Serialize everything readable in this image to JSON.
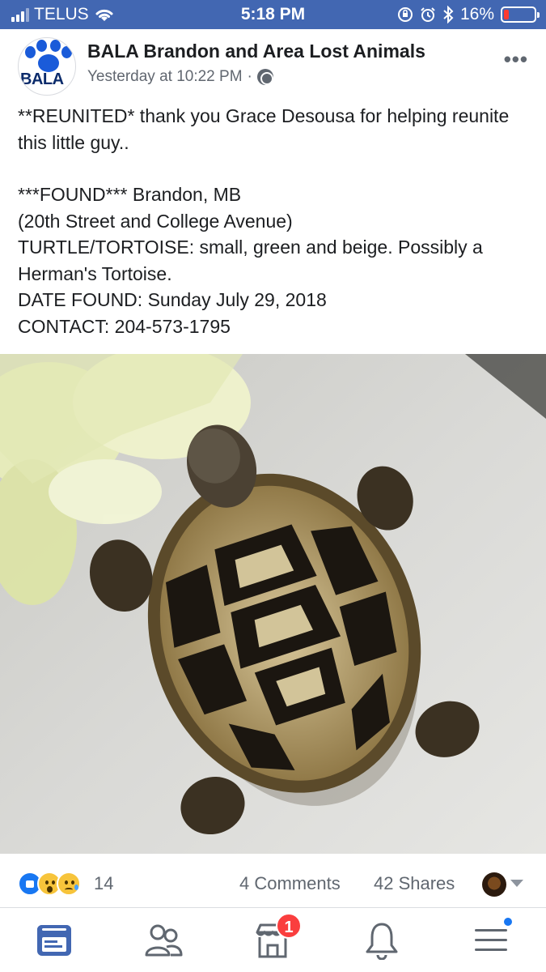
{
  "status_bar": {
    "carrier": "TELUS",
    "time": "5:18 PM",
    "battery": "16%",
    "battery_level": 0.16,
    "icons": [
      "signal-icon",
      "wifi-icon",
      "orientation-lock-icon",
      "alarm-icon",
      "bluetooth-icon",
      "battery-icon"
    ]
  },
  "post": {
    "page_name": "BALA Brandon and Area Lost Animals",
    "avatar_text": "BALA",
    "timestamp": "Yesterday at 10:22 PM",
    "separator": "·",
    "audience_icon": "globe-icon",
    "more": "•••",
    "text": {
      "line1": "**REUNITED* thank you Grace Desousa for helping reunite this little guy..",
      "line2": "***FOUND*** Brandon, MB",
      "line3": "(20th Street and College Avenue)",
      "line4": "TURTLE/TORTOISE:  small, green and beige. Possibly a Herman's Tortoise.",
      "line5": "DATE FOUND: Sunday July 29, 2018",
      "line6": "CONTACT: 204-573-1795"
    },
    "photo_subject": "tortoise-photo"
  },
  "reactions": {
    "types": [
      "like",
      "wow",
      "sad"
    ],
    "count": "14",
    "comments": "4 Comments",
    "shares": "42 Shares"
  },
  "nav": {
    "items": [
      {
        "name": "news-feed",
        "active": true
      },
      {
        "name": "friends"
      },
      {
        "name": "marketplace",
        "badge": "1"
      },
      {
        "name": "notifications"
      },
      {
        "name": "menu",
        "dot": true
      }
    ],
    "accent": "#4267b2",
    "inactive": "#606770"
  },
  "colors": {
    "brand": "#4267b2",
    "text": "#1c1e21",
    "secondary": "#616770",
    "badge": "#fa3e3e"
  }
}
